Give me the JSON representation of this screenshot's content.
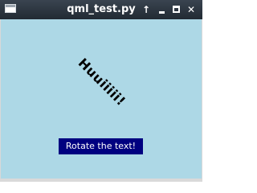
{
  "window": {
    "title": "qml_test.py",
    "controls": {
      "up_glyph": "↑",
      "close_glyph": "✕"
    }
  },
  "content": {
    "background_color": "#add8e6",
    "rotated_text": "Huuiiiii!",
    "rotation_degrees": 45,
    "button_label": "Rotate the text!",
    "button_color": "#000080"
  }
}
